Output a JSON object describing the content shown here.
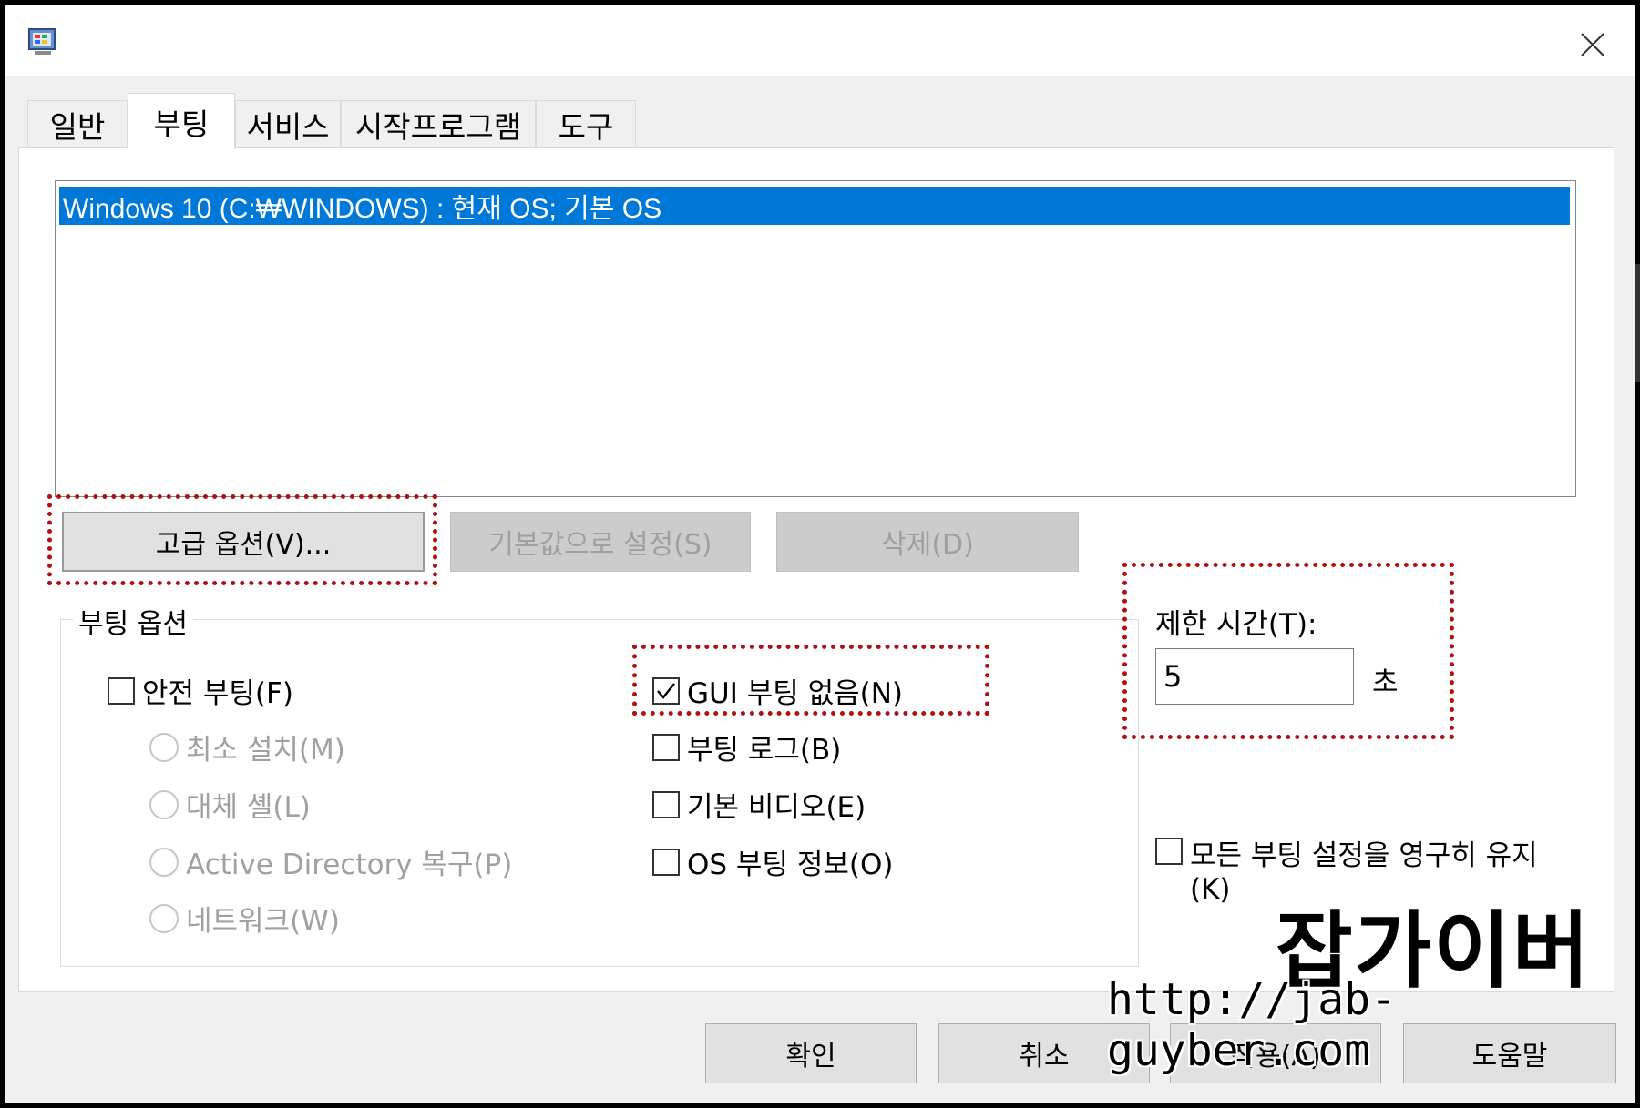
{
  "tabs": [
    "일반",
    "부팅",
    "서비스",
    "시작프로그램",
    "도구"
  ],
  "active_tab": "부팅",
  "os_list": [
    "Windows 10 (C:₩WINDOWS) : 현재 OS; 기본 OS"
  ],
  "buttons": {
    "advanced": "고급 옵션(V)...",
    "set_default": "기본값으로 설정(S)",
    "delete": "삭제(D)"
  },
  "boot_options": {
    "legend": "부팅 옵션",
    "safe_boot": "안전 부팅(F)",
    "minimal": "최소 설치(M)",
    "alternate_shell": "대체 셸(L)",
    "ad_repair": "Active Directory 복구(P)",
    "network": "네트워크(W)",
    "no_gui": "GUI 부팅 없음(N)",
    "boot_log": "부팅 로그(B)",
    "base_video": "기본 비디오(E)",
    "os_boot_info": "OS 부팅 정보(O)"
  },
  "checkbox_states": {
    "safe_boot": false,
    "no_gui": true,
    "boot_log": false,
    "base_video": false,
    "os_boot_info": false,
    "make_permanent": false
  },
  "timeout": {
    "label": "제한 시간(T):",
    "value": "5",
    "unit": "초"
  },
  "make_permanent": {
    "line1": "모든 부팅 설정을 영구히 유지",
    "line2": "(K)"
  },
  "footer": {
    "ok": "확인",
    "cancel": "취소",
    "apply": "적용(A)",
    "help": "도움말"
  },
  "watermark": {
    "title": "잡가이버",
    "url": "http://jab-guyber.com"
  },
  "colors": {
    "selection": "#0078d7",
    "highlight_outline": "#b01010"
  },
  "icons": {
    "app": "msconfig-icon",
    "close": "close-icon",
    "check": "checkmark-icon"
  }
}
